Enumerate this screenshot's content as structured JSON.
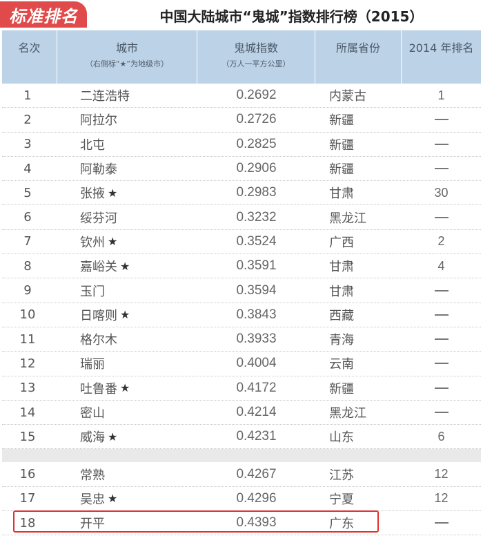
{
  "badge": "标准排名",
  "title": "中国大陆城市“鬼城”指数排行榜（2015）",
  "headers": {
    "rank": "名次",
    "city": "城市",
    "city_note": "（右侧标“★”为地级市）",
    "index": "鬼城指数",
    "index_note": "（万人一平方公里）",
    "province": "所属省份",
    "rank2014": "2014 年排名"
  },
  "star_symbol": "★",
  "dash_meaning": "—",
  "highlight_color": "#e03030",
  "rows_a": [
    {
      "rank": "1",
      "city": "二连浩特",
      "star": false,
      "index": "0.2692",
      "province": "内蒙古",
      "prev": "1"
    },
    {
      "rank": "2",
      "city": "阿拉尔",
      "star": false,
      "index": "0.2726",
      "province": "新疆",
      "prev": "—"
    },
    {
      "rank": "3",
      "city": "北屯",
      "star": false,
      "index": "0.2825",
      "province": "新疆",
      "prev": "—"
    },
    {
      "rank": "4",
      "city": "阿勒泰",
      "star": false,
      "index": "0.2906",
      "province": "新疆",
      "prev": "—"
    },
    {
      "rank": "5",
      "city": "张掖",
      "star": true,
      "index": "0.2983",
      "province": "甘肃",
      "prev": "30"
    },
    {
      "rank": "6",
      "city": "绥芬河",
      "star": false,
      "index": "0.3232",
      "province": "黑龙江",
      "prev": "—"
    },
    {
      "rank": "7",
      "city": "钦州",
      "star": true,
      "index": "0.3524",
      "province": "广西",
      "prev": "2"
    },
    {
      "rank": "8",
      "city": "嘉峪关",
      "star": true,
      "index": "0.3591",
      "province": "甘肃",
      "prev": "4"
    },
    {
      "rank": "9",
      "city": "玉门",
      "star": false,
      "index": "0.3594",
      "province": "甘肃",
      "prev": "—"
    },
    {
      "rank": "10",
      "city": "日喀则",
      "star": true,
      "index": "0.3843",
      "province": "西藏",
      "prev": "—"
    },
    {
      "rank": "11",
      "city": "格尔木",
      "star": false,
      "index": "0.3933",
      "province": "青海",
      "prev": "—"
    },
    {
      "rank": "12",
      "city": "瑞丽",
      "star": false,
      "index": "0.4004",
      "province": "云南",
      "prev": "—"
    },
    {
      "rank": "13",
      "city": "吐鲁番",
      "star": true,
      "index": "0.4172",
      "province": "新疆",
      "prev": "—"
    },
    {
      "rank": "14",
      "city": "密山",
      "star": false,
      "index": "0.4214",
      "province": "黑龙江",
      "prev": "—"
    },
    {
      "rank": "15",
      "city": "威海",
      "star": true,
      "index": "0.4231",
      "province": "山东",
      "prev": "6"
    }
  ],
  "rows_b": [
    {
      "rank": "16",
      "city": "常熟",
      "star": false,
      "index": "0.4267",
      "province": "江苏",
      "prev": "12"
    },
    {
      "rank": "17",
      "city": "吴忠",
      "star": true,
      "index": "0.4296",
      "province": "宁夏",
      "prev": "12"
    },
    {
      "rank": "18",
      "city": "开平",
      "star": false,
      "index": "0.4393",
      "province": "广东",
      "prev": "—"
    }
  ]
}
